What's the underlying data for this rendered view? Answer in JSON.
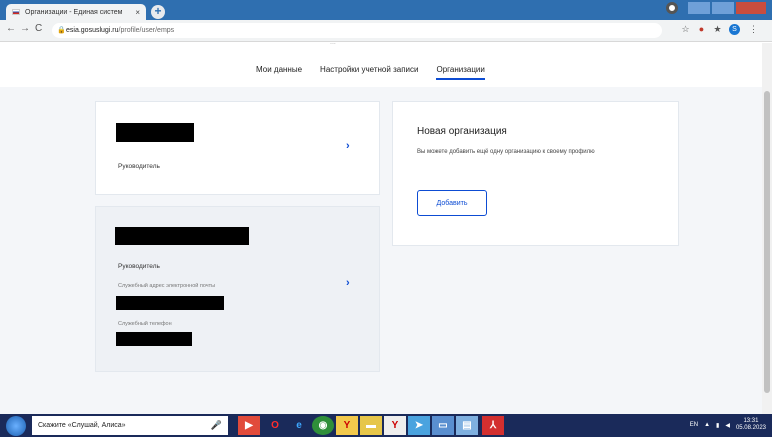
{
  "browser": {
    "tab_title": "Организации - Единая систем",
    "tab_close": "×",
    "new_tab": "+",
    "url_host": "esia.gosuslugi.ru",
    "url_path": "/profile/user/emps",
    "lock": "🔒",
    "back": "←",
    "forward": "→",
    "reload": "C",
    "star": "☆",
    "extension_puzzle": "★",
    "avatar_letter": "S",
    "menu_dots": "⋮"
  },
  "header": {
    "truncated_text": "...",
    "menu": [
      {
        "label": "Мои данные"
      },
      {
        "label": "Настройки учетной записи"
      },
      {
        "label": "Организации"
      }
    ]
  },
  "org1": {
    "role": "Руководитель",
    "chevron": "›"
  },
  "org2": {
    "role": "Руководитель",
    "email_label": "Служебный адрес электронной почты",
    "phone_label": "Служебный телефон",
    "chevron": "›"
  },
  "new_org": {
    "title": "Новая организация",
    "description": "Вы можете добавить ещё одну организацию к своему профилю",
    "button": "Добавить"
  },
  "taskbar": {
    "search_text": "Скажите «Слушай, Алиса»",
    "mic": "🎤",
    "lang": "EN",
    "time": "13:31",
    "date": "05.08.2023"
  },
  "colors": {
    "accent": "#0d4cd3",
    "titlebar": "#2f6fb0",
    "taskbar": "#1a2a5a",
    "page_bg": "#f4f6f9"
  }
}
